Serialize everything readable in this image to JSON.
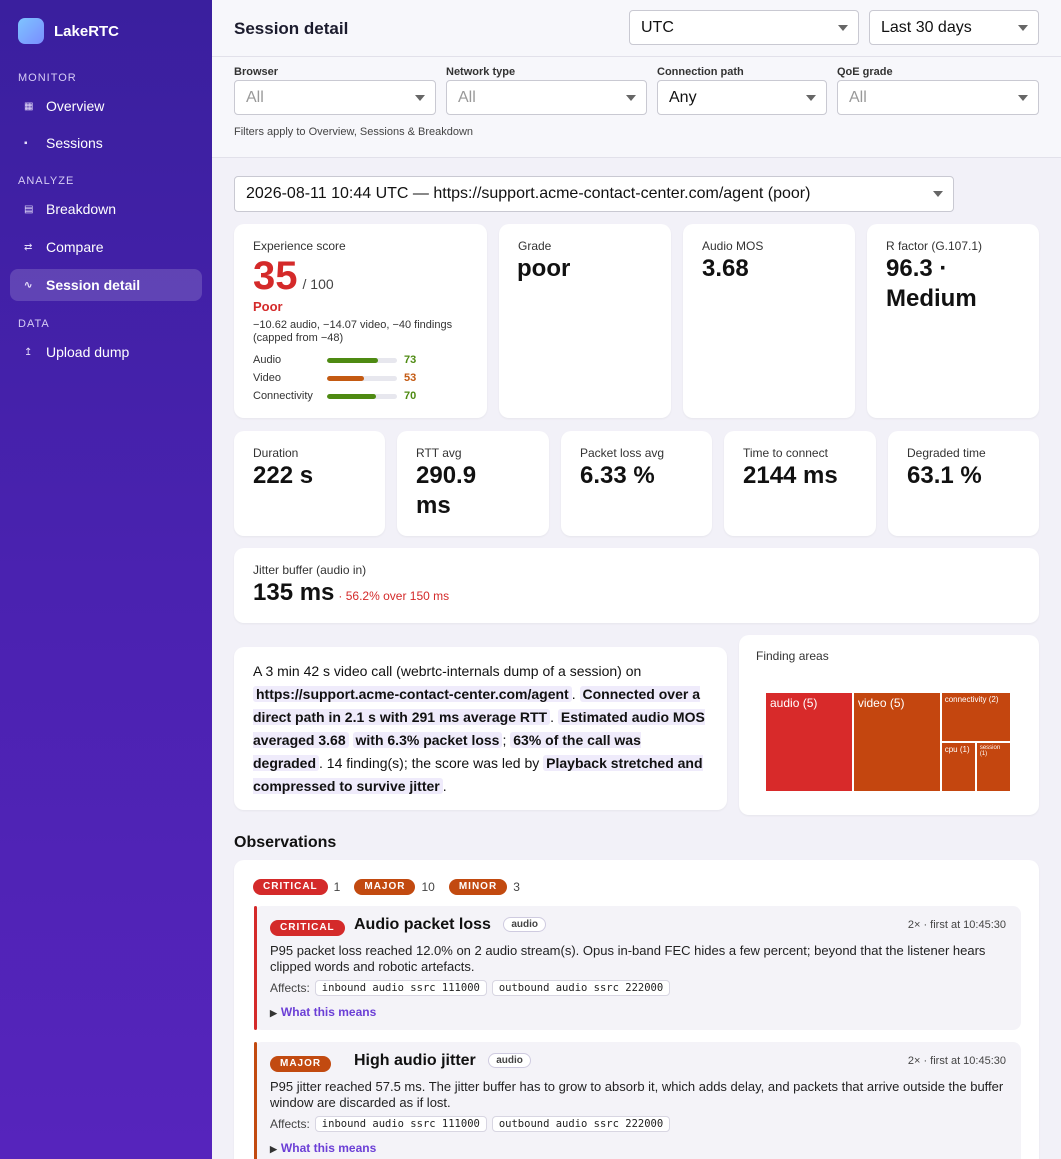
{
  "app": {
    "name": "LakeRTC"
  },
  "sidebar": {
    "sections": [
      {
        "label": "MONITOR"
      },
      {
        "label": "ANALYZE"
      },
      {
        "label": "DATA"
      }
    ],
    "items": [
      {
        "label": "Overview",
        "icon": "▦"
      },
      {
        "label": "Sessions",
        "icon": "▪"
      },
      {
        "label": "Breakdown",
        "icon": "▤"
      },
      {
        "label": "Compare",
        "icon": "⇄"
      },
      {
        "label": "Session detail",
        "icon": "∿"
      },
      {
        "label": "Upload dump",
        "icon": "↥"
      }
    ]
  },
  "header": {
    "title": "Session detail",
    "timezone": "UTC",
    "range": "Last 30 days"
  },
  "filters": {
    "browser": {
      "label": "Browser",
      "value": "All"
    },
    "network": {
      "label": "Network type",
      "value": "All"
    },
    "path": {
      "label": "Connection path",
      "value": "Any"
    },
    "qoe": {
      "label": "QoE grade",
      "value": "All"
    },
    "note": "Filters apply to Overview, Sessions & Breakdown"
  },
  "session_select": "2026-08-11 10:44 UTC — https://support.acme-contact-center.com/agent (poor)",
  "score": {
    "label": "Experience score",
    "value": "35",
    "max": "/ 100",
    "grade": "Poor",
    "note": "−10.62 audio, −14.07 video, −40 findings (capped from −48)",
    "bars": [
      {
        "name": "Audio",
        "value": 73,
        "display": "73",
        "color": "#4e8a12"
      },
      {
        "name": "Video",
        "value": 53,
        "display": "53",
        "color": "#c45a12"
      },
      {
        "name": "Connectivity",
        "value": 70,
        "display": "70",
        "color": "#4e8a12"
      }
    ]
  },
  "kpis_top": [
    {
      "label": "Grade",
      "value": "poor"
    },
    {
      "label": "Audio MOS",
      "value": "3.68"
    },
    {
      "label": "R factor (G.107.1)",
      "value": "96.3 · Medium"
    }
  ],
  "kpis_mid": [
    {
      "label": "Duration",
      "value": "222 s"
    },
    {
      "label": "RTT avg",
      "value": "290.9 ms"
    },
    {
      "label": "Packet loss avg",
      "value": "6.33 %"
    },
    {
      "label": "Time to connect",
      "value": "2144 ms"
    },
    {
      "label": "Degraded time",
      "value": "63.1 %"
    }
  ],
  "jitter": {
    "label": "Jitter buffer (audio in)",
    "value": "135 ms",
    "note": "· 56.2% over 150 ms"
  },
  "summary": {
    "t1": "A 3 min 42 s video call (webrtc-internals dump of a session) on",
    "h1": "https://support.acme-contact-center.com/agent",
    "t2": ".",
    "h2": "Connected over a direct path in 2.1 s with 291 ms average RTT",
    "t3": ".",
    "h3": "Estimated audio MOS averaged 3.68",
    "t4": "",
    "h4": "with 6.3% packet loss",
    "t5": ";",
    "h5": "63% of the call was degraded",
    "t6": ". 14 finding(s); the score was led by",
    "h6": "Playback stretched and compressed to survive jitter",
    "t7": "."
  },
  "finding_areas": {
    "title": "Finding areas",
    "cells": [
      {
        "label": "audio (5)",
        "count": 5,
        "color": "#d82a2a"
      },
      {
        "label": "video (5)",
        "count": 5,
        "color": "#c4460f"
      },
      {
        "label": "connectivity (2)",
        "count": 2,
        "color": "#c4460f"
      },
      {
        "label": "cpu (1)",
        "count": 1,
        "color": "#c4460f"
      },
      {
        "label": "session (1)",
        "count": 1,
        "color": "#c4460f"
      }
    ]
  },
  "observations": {
    "title": "Observations",
    "counts": [
      {
        "label": "CRITICAL",
        "count": "1"
      },
      {
        "label": "MAJOR",
        "count": "10"
      },
      {
        "label": "MINOR",
        "count": "3"
      }
    ],
    "items": [
      {
        "severity": "CRITICAL",
        "title": "Audio packet loss",
        "tag": "audio",
        "meta": "2× · first at 10:45:30",
        "desc": "P95 packet loss reached 12.0% on 2 audio stream(s). Opus in-band FEC hides a few percent; beyond that the listener hears clipped words and robotic artefacts.",
        "affects_label": "Affects:",
        "affects": [
          "inbound audio ssrc 111000",
          "outbound audio ssrc 222000"
        ],
        "more": "What this means"
      },
      {
        "severity": "MAJOR",
        "title": "High audio jitter",
        "tag": "audio",
        "meta": "2× · first at 10:45:30",
        "desc": "P95 jitter reached 57.5 ms. The jitter buffer has to grow to absorb it, which adds delay, and packets that arrive outside the buffer window are discarded as if lost.",
        "affects_label": "Affects:",
        "affects": [
          "inbound audio ssrc 111000",
          "outbound audio ssrc 222000"
        ],
        "more": "What this means"
      }
    ]
  },
  "colors": {
    "accent": "#4a22b0",
    "critical": "#d42a2a",
    "major": "#c24a10",
    "good": "#4e8a12"
  }
}
